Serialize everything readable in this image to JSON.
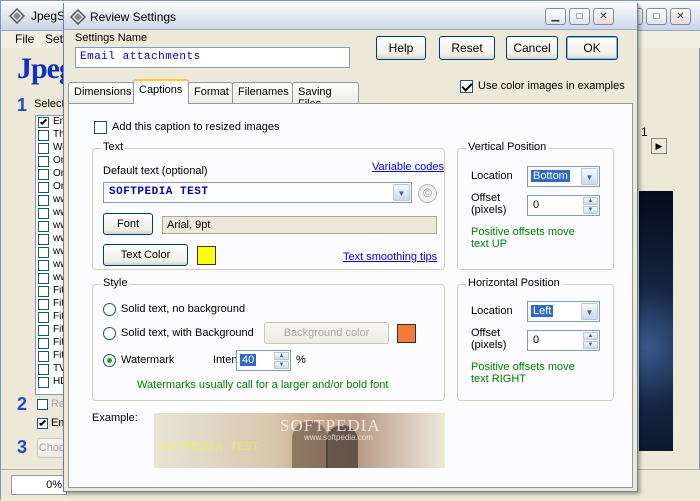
{
  "background": {
    "title": "JpegSh",
    "menu": [
      "File",
      "Set"
    ],
    "big_title": "Jpeg",
    "step1": "1",
    "step1_label": "Select",
    "step2": "2",
    "step2_label": "Re",
    "step2b_label": "Em",
    "step3": "3",
    "step3_btn": "Choo",
    "list": [
      {
        "label": "Em",
        "checked": true
      },
      {
        "label": "Th"
      },
      {
        "label": "We"
      },
      {
        "label": "Or"
      },
      {
        "label": "Or"
      },
      {
        "label": "Or"
      },
      {
        "label": "ww"
      },
      {
        "label": "ww"
      },
      {
        "label": "ww"
      },
      {
        "label": "ww"
      },
      {
        "label": "ww"
      },
      {
        "label": "ww"
      },
      {
        "label": "ww"
      },
      {
        "label": "Fit"
      },
      {
        "label": "Fit"
      },
      {
        "label": "Fit"
      },
      {
        "label": "Fit"
      },
      {
        "label": "Fit"
      },
      {
        "label": "Fit"
      },
      {
        "label": "TV"
      },
      {
        "label": "HD"
      }
    ],
    "page_number": "1",
    "progress": "0%"
  },
  "dialog": {
    "title": "Review Settings",
    "settings_name_label": "Settings Name",
    "settings_name_value": "Email attachments",
    "buttons": {
      "help": "Help",
      "reset": "Reset",
      "cancel": "Cancel",
      "ok": "OK"
    },
    "use_color_label": "Use color images in examples",
    "use_color_checked": true,
    "tabs": [
      "Dimensions",
      "Captions",
      "Format",
      "Filenames",
      "Saving Files"
    ],
    "active_tab": "Captions",
    "add_caption_label": "Add this caption to resized images",
    "add_caption_checked": false,
    "text_group": {
      "caption": "Text",
      "default_text_label": "Default text (optional)",
      "variable_codes": "Variable codes",
      "default_text_value": "SOFTPEDIA TEST",
      "font_button": "Font",
      "font_value": "Arial, 9pt",
      "text_color_button": "Text Color",
      "text_color": "#ffff00",
      "smoothing_link": "Text smoothing tips"
    },
    "style_group": {
      "caption": "Style",
      "option_solid": "Solid text, no background",
      "option_background": "Solid text, with Background",
      "background_color_button": "Background color",
      "background_color": "#f47a3c",
      "option_watermark": "Watermark",
      "selected_option": "Watermark",
      "intensity_label": "Intensity",
      "intensity_value": "40",
      "percent": "%",
      "watermark_note": "Watermarks usually call for a larger and/or bold font"
    },
    "vertical": {
      "caption": "Vertical Position",
      "location_label": "Location",
      "location_value": "Bottom",
      "offset_label": "Offset",
      "offset_label2": "(pixels)",
      "offset_value": "0",
      "note": "Positive offsets move text UP"
    },
    "horizontal": {
      "caption": "Horizontal Position",
      "location_label": "Location",
      "location_value": "Left",
      "offset_label": "Offset",
      "offset_label2": "(pixels)",
      "offset_value": "0",
      "note": "Positive offsets move text RIGHT"
    },
    "example_label": "Example:",
    "example_watermark": "SOFTPEDIA",
    "example_watermark_sub": "www.softpedia.com",
    "example_caption": "SOFTPEDIA TEST"
  }
}
